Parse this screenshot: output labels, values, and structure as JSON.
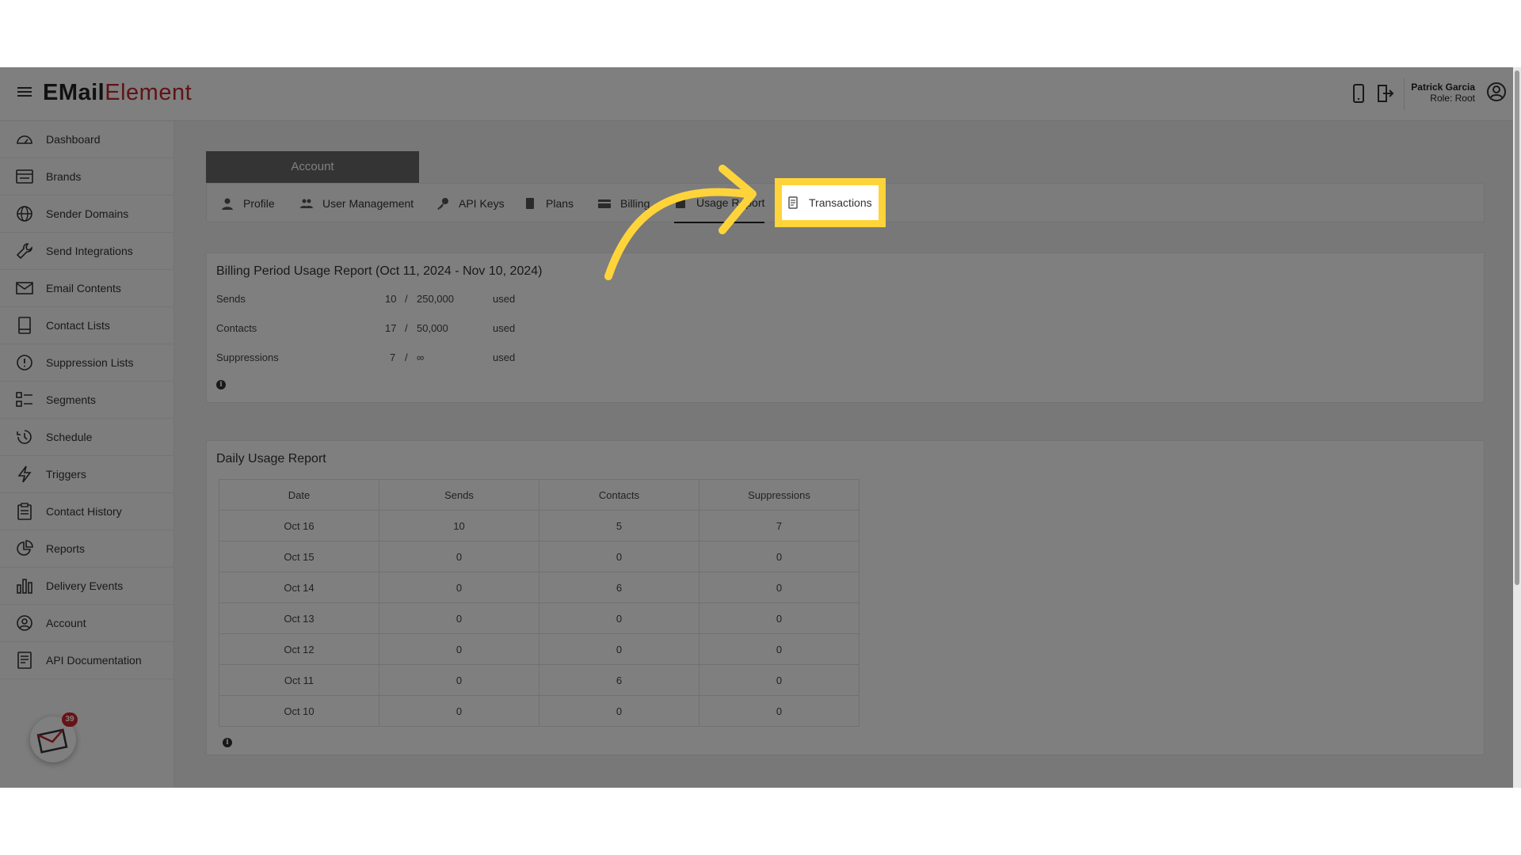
{
  "app": {
    "logo_part1": "EMail",
    "logo_part2": "Element"
  },
  "header": {
    "user_name": "Patrick Garcia",
    "user_role": "Role: Root",
    "icons": [
      "mobile-icon",
      "logout-icon",
      "user-circle-icon"
    ]
  },
  "sidebar": {
    "items": [
      {
        "label": "Dashboard",
        "icon": "dashboard-icon"
      },
      {
        "label": "Brands",
        "icon": "brands-icon"
      },
      {
        "label": "Sender Domains",
        "icon": "globe-icon"
      },
      {
        "label": "Send Integrations",
        "icon": "wrench-icon"
      },
      {
        "label": "Email Contents",
        "icon": "envelope-icon"
      },
      {
        "label": "Contact Lists",
        "icon": "book-icon"
      },
      {
        "label": "Suppression Lists",
        "icon": "alert-circle-icon"
      },
      {
        "label": "Segments",
        "icon": "segments-icon"
      },
      {
        "label": "Schedule",
        "icon": "history-icon"
      },
      {
        "label": "Triggers",
        "icon": "lightning-icon"
      },
      {
        "label": "Contact History",
        "icon": "clipboard-icon"
      },
      {
        "label": "Reports",
        "icon": "pie-chart-icon"
      },
      {
        "label": "Delivery Events",
        "icon": "bar-chart-icon"
      },
      {
        "label": "Account",
        "icon": "account-circle-icon"
      },
      {
        "label": "API Documentation",
        "icon": "document-icon"
      }
    ],
    "notification_count": "39"
  },
  "account": {
    "title": "Account",
    "tabs": [
      {
        "label": "Profile",
        "icon": "person-icon"
      },
      {
        "label": "User Management",
        "icon": "users-icon"
      },
      {
        "label": "API Keys",
        "icon": "key-icon"
      },
      {
        "label": "Plans",
        "icon": "plan-icon"
      },
      {
        "label": "Billing",
        "icon": "card-icon"
      },
      {
        "label": "Usage Report",
        "icon": "report-icon"
      },
      {
        "label": "Transactions",
        "icon": "receipt-icon"
      }
    ],
    "highlighted_tab": "Transactions"
  },
  "billing_report": {
    "title": "Billing Period Usage Report (Oct 11, 2024 - Nov 10, 2024)",
    "rows": [
      {
        "label": "Sends",
        "used": "10",
        "sep": "/",
        "limit": "250,000",
        "suffix": "used"
      },
      {
        "label": "Contacts",
        "used": "17",
        "sep": "/",
        "limit": "50,000",
        "suffix": "used"
      },
      {
        "label": "Suppressions",
        "used": "7",
        "sep": "/",
        "limit": "∞",
        "suffix": "used"
      }
    ]
  },
  "daily_report": {
    "title": "Daily Usage Report",
    "columns": [
      "Date",
      "Sends",
      "Contacts",
      "Suppressions"
    ],
    "rows": [
      [
        "Oct 16",
        "10",
        "5",
        "7"
      ],
      [
        "Oct 15",
        "0",
        "0",
        "0"
      ],
      [
        "Oct 14",
        "0",
        "6",
        "0"
      ],
      [
        "Oct 13",
        "0",
        "0",
        "0"
      ],
      [
        "Oct 12",
        "0",
        "0",
        "0"
      ],
      [
        "Oct 11",
        "0",
        "6",
        "0"
      ],
      [
        "Oct 10",
        "0",
        "0",
        "0"
      ]
    ]
  },
  "colors": {
    "brand_red": "#c0272d",
    "highlight_yellow": "#ffd43b",
    "overlay": "rgba(0,0,0,0.5)"
  }
}
